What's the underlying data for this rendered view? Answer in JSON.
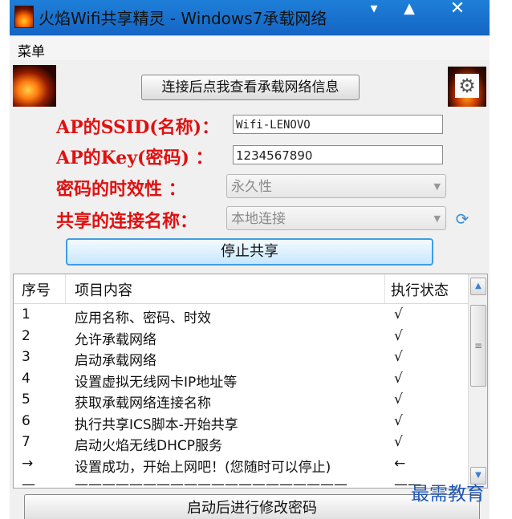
{
  "window": {
    "title": "火焰Wifi共享精灵 - Windows7承载网络",
    "minimize_glyph": "▾",
    "maximize_glyph": "▲",
    "close_glyph": "✕"
  },
  "menubar": {
    "menu_label": "菜单"
  },
  "header": {
    "view_hosted_network_label": "连接后点我查看承载网络信息",
    "settings_icon_glyph": "⚙"
  },
  "form": {
    "ssid_label": "AP的SSID(名称)：",
    "ssid_value": "Wifi-LENOVO",
    "key_label": "AP的Key(密码) ：",
    "key_value": "1234567890",
    "expiry_label": "密码的时效性 ：",
    "expiry_value": "永久性",
    "share_label": "共享的连接名称：",
    "share_value": "本地连接",
    "dropdown_glyph": "▼",
    "refresh_glyph": "⟳",
    "stop_sharing_label": "停止共享"
  },
  "table": {
    "columns": [
      "序号",
      "项目内容",
      "执行状态"
    ],
    "rows": [
      [
        "1",
        "应用名称、密码、时效",
        "√"
      ],
      [
        "2",
        "允许承载网络",
        "√"
      ],
      [
        "3",
        "启动承载网络",
        "√"
      ],
      [
        "4",
        "设置虚拟无线网卡IP地址等",
        "√"
      ],
      [
        "5",
        "获取承载网络连接名称",
        "√"
      ],
      [
        "6",
        "执行共享ICS脚本-开始共享",
        "√"
      ],
      [
        "7",
        "启动火焰无线DHCP服务",
        "√"
      ],
      [
        "→",
        "设置成功，开始上网吧！(您随时可以停止)",
        "←"
      ],
      [
        "—",
        "————————————————————",
        "——"
      ]
    ],
    "scroll_up_glyph": "▲",
    "scroll_down_glyph": "▼",
    "scroll_grip_glyph": "≡"
  },
  "footer": {
    "change_password_label": "启动后进行修改密码"
  },
  "watermark": "最需教育",
  "colors": {
    "label_red": "#e01010",
    "titlebar_blue": "#1e7fd8",
    "stop_button_border": "#3f9de6",
    "watermark_blue": "#1f57b5"
  }
}
